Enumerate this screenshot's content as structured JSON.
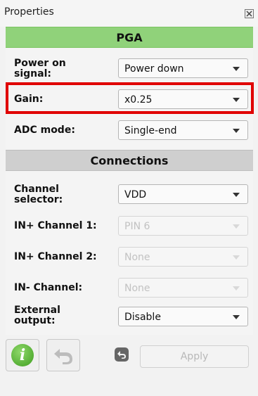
{
  "window": {
    "title": "Properties"
  },
  "pga": {
    "header": "PGA",
    "power_on_signal": {
      "label_line1": "Power on",
      "label_line2": "signal:",
      "value": "Power down"
    },
    "gain": {
      "label": "Gain:",
      "value": "x0.25"
    },
    "adc_mode": {
      "label": "ADC mode:",
      "value": "Single-end"
    }
  },
  "connections": {
    "header": "Connections",
    "channel_selector": {
      "label_line1": "Channel",
      "label_line2": "selector:",
      "value": "VDD"
    },
    "in_plus_1": {
      "label": "IN+ Channel 1:",
      "value": "PIN 6"
    },
    "in_plus_2": {
      "label": "IN+ Channel 2:",
      "value": "None"
    },
    "in_minus": {
      "label": "IN- Channel:",
      "value": "None"
    },
    "external_output": {
      "label_line1": "External",
      "label_line2": "output:",
      "value": "Disable"
    }
  },
  "toolbar": {
    "info_glyph": "i",
    "apply_label": "Apply"
  },
  "colors": {
    "pga_header": "#90d27a",
    "connections_header": "#cfcfcf",
    "highlight": "#e00000"
  }
}
